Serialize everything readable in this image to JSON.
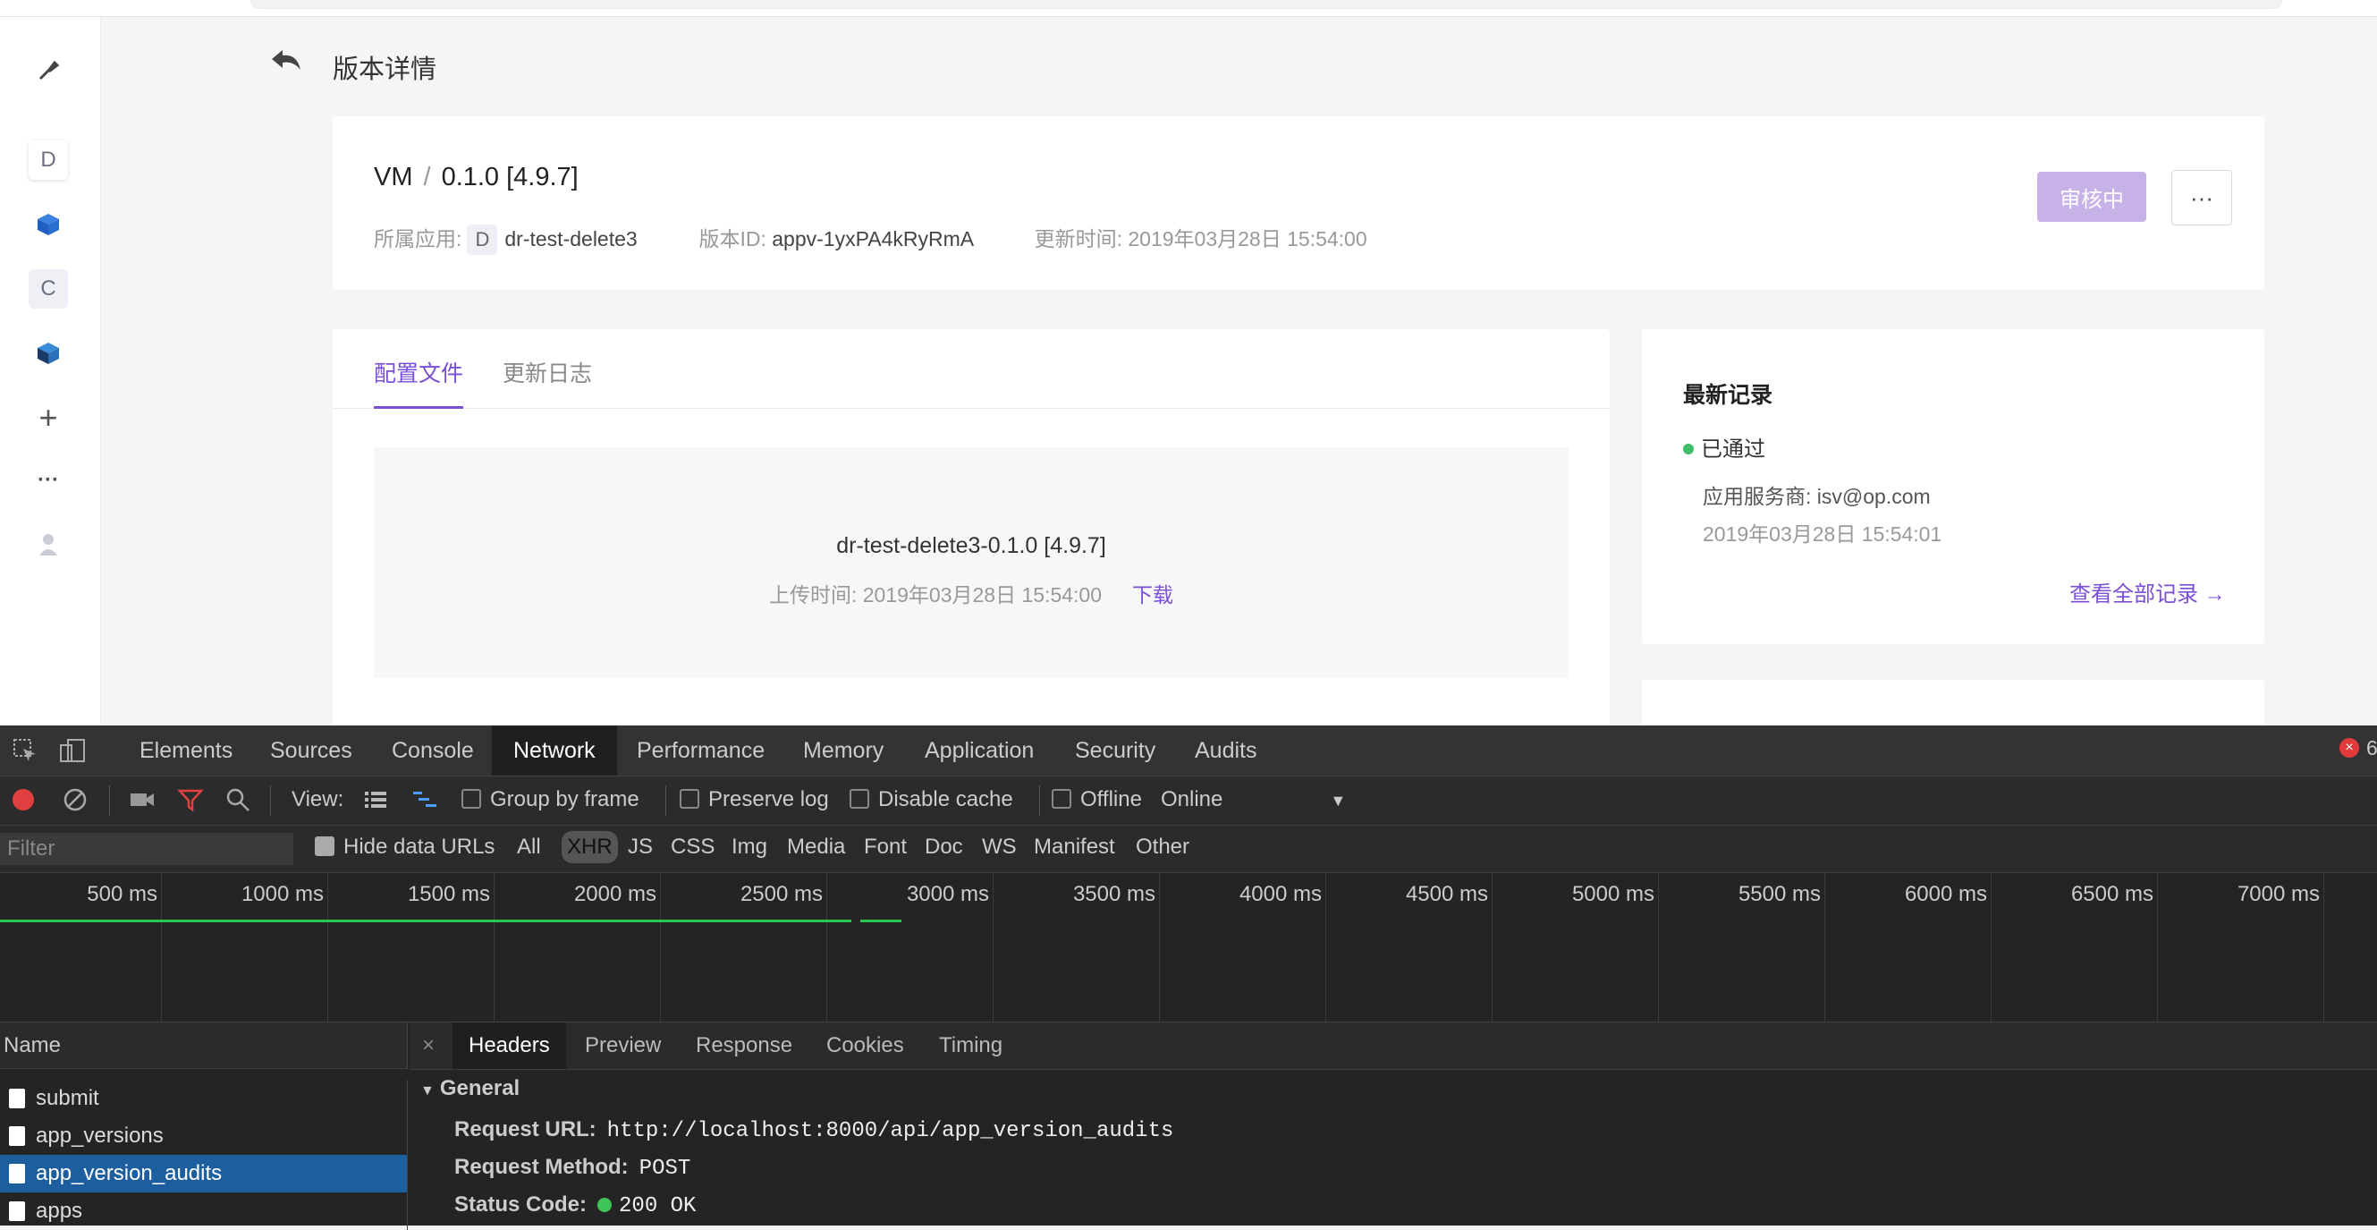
{
  "page": {
    "title": "版本详情",
    "back_icon": "back-arrow-icon"
  },
  "sidenav": {
    "items": [
      {
        "name": "tool-icon",
        "glyph": "🔧"
      },
      {
        "name": "app-d",
        "label": "D"
      },
      {
        "name": "cube-blue-icon",
        "glyph": "◆"
      },
      {
        "name": "app-c",
        "label": "C"
      },
      {
        "name": "cube-dark-icon",
        "glyph": "◆"
      },
      {
        "name": "add-icon",
        "glyph": "+"
      },
      {
        "name": "more-icon",
        "glyph": "···"
      },
      {
        "name": "user-icon",
        "glyph": "●"
      }
    ]
  },
  "version": {
    "app": "VM",
    "separator": "/",
    "number": "0.1.0 [4.9.7]",
    "app_label": "所属应用:",
    "app_badge": "D",
    "app_name": "dr-test-delete3",
    "id_label": "版本ID:",
    "id_value": "appv-1yxPA4kRyRmA",
    "updated_label": "更新时间:",
    "updated_value": "2019年03月28日 15:54:00",
    "status_button": "审核中",
    "more_button": "···"
  },
  "config": {
    "tabs": [
      "配置文件",
      "更新日志"
    ],
    "file_name": "dr-test-delete3-0.1.0 [4.9.7]",
    "upload_text": "上传时间: 2019年03月28日 15:54:00",
    "download": "下载"
  },
  "records": {
    "title": "最新记录",
    "status": "已通过",
    "provider": "应用服务商: isv@op.com",
    "time": "2019年03月28日 15:54:01",
    "view_all": "查看全部记录 →"
  },
  "devtools": {
    "tabs": [
      "Elements",
      "Sources",
      "Console",
      "Network",
      "Performance",
      "Memory",
      "Application",
      "Security",
      "Audits"
    ],
    "active_tab": "Network",
    "error_count": "6",
    "toolbar": {
      "view_label": "View:",
      "group_by_frame": "Group by frame",
      "preserve_log": "Preserve log",
      "disable_cache": "Disable cache",
      "offline": "Offline",
      "throttle": "Online"
    },
    "filter": {
      "placeholder": "Filter",
      "hide_data_urls": "Hide data URLs",
      "types": [
        "All",
        "XHR",
        "JS",
        "CSS",
        "Img",
        "Media",
        "Font",
        "Doc",
        "WS",
        "Manifest",
        "Other"
      ],
      "active_type": "XHR"
    },
    "timeline_ticks": [
      "500 ms",
      "1000 ms",
      "1500 ms",
      "2000 ms",
      "2500 ms",
      "3000 ms",
      "3500 ms",
      "4000 ms",
      "4500 ms",
      "5000 ms",
      "5500 ms",
      "6000 ms",
      "6500 ms",
      "7000 ms"
    ],
    "list_header": "Name",
    "requests": [
      "submit",
      "app_versions",
      "app_version_audits",
      "apps"
    ],
    "selected_request": "app_version_audits",
    "detail_tabs": [
      "Headers",
      "Preview",
      "Response",
      "Cookies",
      "Timing"
    ],
    "detail_close": "×",
    "general_label": "General",
    "general": [
      {
        "key": "Request URL:",
        "value": "http://localhost:8000/api/app_version_audits"
      },
      {
        "key": "Request Method:",
        "value": "POST"
      },
      {
        "key": "Status Code:",
        "value": "200 OK"
      }
    ]
  },
  "colors": {
    "accent": "#7a4fd6",
    "status_button": "#c7b2e8",
    "success": "#3fbf6a",
    "selected_row": "#1d5f9e",
    "devtools_bg": "#242424"
  }
}
